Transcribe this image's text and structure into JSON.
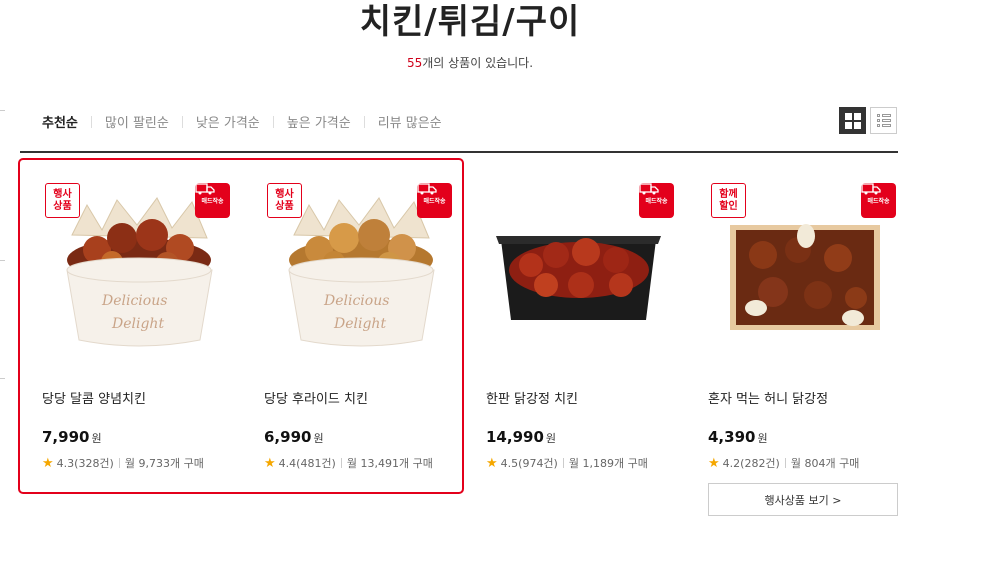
{
  "header": {
    "title": "치킨/튀김/구이",
    "count_num": "55",
    "count_suffix": "개의 상품이 있습니다."
  },
  "sort_tabs": [
    {
      "label": "추천순",
      "active": true
    },
    {
      "label": "많이 팔린순",
      "active": false
    },
    {
      "label": "낮은 가격순",
      "active": false
    },
    {
      "label": "높은 가격순",
      "active": false
    },
    {
      "label": "리뷰 많은순",
      "active": false
    }
  ],
  "view_toggle": {
    "active": "grid",
    "icons": [
      "grid-view-icon",
      "list-view-icon"
    ]
  },
  "colors": {
    "accent": "#e3001b",
    "star": "#f5a700",
    "divider": "#333333"
  },
  "products": [
    {
      "name": "당당 달콤 양념치킨",
      "price": "7,990",
      "won": "원",
      "rating": "4.3(328건)",
      "monthly": "월 9,733개 구매",
      "badge_event": "행사\n상품",
      "delivery_badge": "매드작송",
      "image": "cup-seasoned-chicken"
    },
    {
      "name": "당당 후라이드 치킨",
      "price": "6,990",
      "won": "원",
      "rating": "4.4(481건)",
      "monthly": "월 13,491개 구매",
      "badge_event": "행사\n상품",
      "delivery_badge": "매드작송",
      "image": "cup-fried-chicken"
    },
    {
      "name": "한판 닭강정 치킨",
      "price": "14,990",
      "won": "원",
      "rating": "4.5(974건)",
      "monthly": "월 1,189개 구매",
      "badge_event": "",
      "delivery_badge": "매드작송",
      "image": "tray-dakgangjeong"
    },
    {
      "name": "혼자 먹는 허니 닭강정",
      "price": "4,390",
      "won": "원",
      "rating": "4.2(282건)",
      "monthly": "월 804개 구매",
      "badge_event": "함께\n할인",
      "delivery_badge": "매드작송",
      "image": "box-honey-dakgangjeong"
    }
  ],
  "more_button": "행사상품 보기 >"
}
